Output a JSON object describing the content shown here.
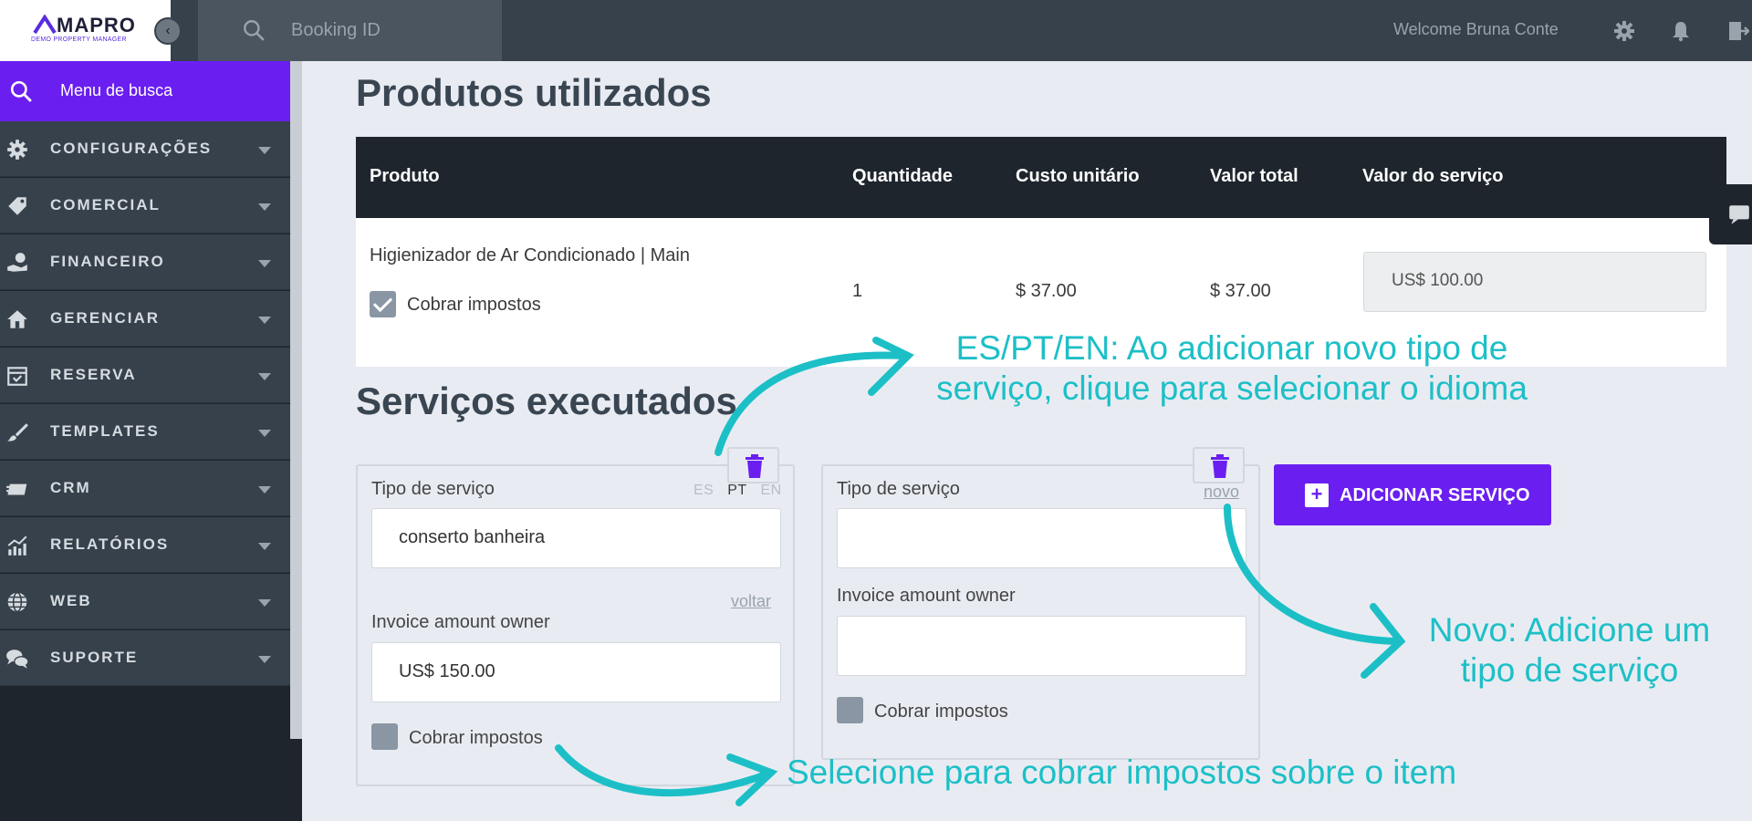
{
  "topbar": {
    "logo": "MAPRO",
    "logo_subtitle": "DEMO PROPERTY MANAGER",
    "search_placeholder": "Booking ID",
    "welcome": "Welcome Bruna Conte"
  },
  "sidebar": {
    "menu_search": "Menu de busca",
    "items": [
      {
        "label": "CONFIGURAÇÕES",
        "icon": "gear-icon"
      },
      {
        "label": "COMERCIAL",
        "icon": "tag-icon"
      },
      {
        "label": "FINANCEIRO",
        "icon": "money-hand-icon"
      },
      {
        "label": "GERENCIAR",
        "icon": "house-icon"
      },
      {
        "label": "RESERVA",
        "icon": "calendar-check-icon"
      },
      {
        "label": "TEMPLATES",
        "icon": "brush-icon"
      },
      {
        "label": "CRM",
        "icon": "card-icon"
      },
      {
        "label": "RELATÓRIOS",
        "icon": "chart-icon"
      },
      {
        "label": "WEB",
        "icon": "globe-icon"
      },
      {
        "label": "SUPORTE",
        "icon": "chat-icon"
      }
    ]
  },
  "products": {
    "title": "Produtos utilizados",
    "headers": {
      "product": "Produto",
      "quantity": "Quantidade",
      "unit_cost": "Custo unitário",
      "total": "Valor total",
      "service_value": "Valor do serviço"
    },
    "row": {
      "product": "Higienizador de Ar Condicionado | Main",
      "charge_taxes": "Cobrar impostos",
      "quantity": "1",
      "unit_cost": "$ 37.00",
      "total": "$ 37.00",
      "service_value": "US$ 100.00"
    }
  },
  "services": {
    "title": "Serviços executados",
    "card1": {
      "type_label": "Tipo de serviço",
      "lang_es": "ES",
      "lang_pt": "PT",
      "lang_en": "EN",
      "type_value": "conserto banheira",
      "back_link": "voltar",
      "amount_label": "Invoice amount owner",
      "amount_value": "US$ 150.00",
      "charge_taxes": "Cobrar impostos"
    },
    "card2": {
      "type_label": "Tipo de serviço",
      "new_link": "novo",
      "amount_label": "Invoice amount owner",
      "charge_taxes": "Cobrar impostos"
    },
    "add_button": "ADICIONAR SERVIÇO"
  },
  "annotations": {
    "lang_line1": "ES/PT/EN: Ao adicionar novo tipo de",
    "lang_line2": "serviço, clique para selecionar o idioma",
    "new_line1": "Novo: Adicione um",
    "new_line2": "tipo de serviço",
    "taxes": "Selecione para cobrar impostos sobre o item"
  },
  "colors": {
    "accent": "#6a1ff0",
    "annotation": "#1dbfc7",
    "dark": "#1e252c",
    "topbar": "#36414c"
  }
}
